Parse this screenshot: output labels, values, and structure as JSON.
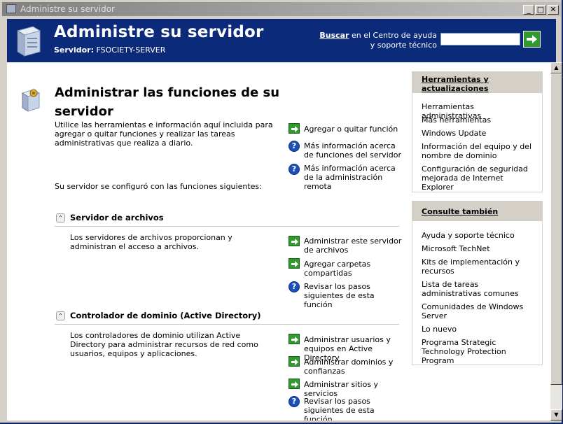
{
  "window": {
    "title": "Administre su servidor",
    "controls": {
      "minimize": "_",
      "maximize": "□",
      "close": "✕"
    }
  },
  "header": {
    "title": "Administre su servidor",
    "server_label": "Servidor:",
    "server_name": "FSOCIETY-SERVER",
    "search": {
      "label_bold": "Buscar",
      "label_rest": " en el Centro de ayuda y soporte técnico",
      "value": "",
      "placeholder": ""
    }
  },
  "main": {
    "title": "Administrar las funciones de su servidor",
    "intro": "Utilice las herramientas e información aquí incluida para agregar o quitar funciones y realizar las tareas administrativas que realiza a diario.",
    "configured": "Su servidor se configuró con las funciones siguientes:",
    "top_links": [
      {
        "label": "Agregar o quitar función",
        "icon": "arrow-right-icon"
      },
      {
        "label": "Más información acerca de funciones del servidor",
        "icon": "help-icon"
      },
      {
        "label": "Más información acerca de la administración remota",
        "icon": "help-icon"
      }
    ],
    "sections": [
      {
        "title": "Servidor de archivos",
        "description": "Los servidores de archivos proporcionan y administran el acceso a archivos.",
        "links": [
          {
            "label": "Administrar este servidor de archivos",
            "icon": "arrow-right-icon"
          },
          {
            "label": "Agregar carpetas compartidas",
            "icon": "arrow-right-icon"
          },
          {
            "label": "Revisar los pasos siguientes de esta función",
            "icon": "help-icon"
          }
        ]
      },
      {
        "title": "Controlador de dominio (Active Directory)",
        "description": "Los controladores de dominio utilizan Active Directory para administrar recursos de red como usuarios, equipos y aplicaciones.",
        "links": [
          {
            "label": "Administrar usuarios y equipos en Active Directory",
            "icon": "arrow-right-icon"
          },
          {
            "label": "Administrar dominios y confianzas",
            "icon": "arrow-right-icon"
          },
          {
            "label": "Administrar sitios y servicios",
            "icon": "arrow-right-icon"
          },
          {
            "label": "Revisar los pasos siguientes de esta función",
            "icon": "help-icon"
          }
        ]
      }
    ]
  },
  "sidebar": {
    "tools": {
      "title": "Herramientas y actualizaciones",
      "items": [
        "Herramientas administrativas",
        "Más herramientas",
        "Windows Update",
        "Información del equipo y del nombre de dominio",
        "Configuración de seguridad mejorada de Internet Explorer"
      ]
    },
    "see_also": {
      "title": "Consulte también",
      "items": [
        "Ayuda y soporte técnico",
        "Microsoft TechNet",
        "Kits de implementación y recursos",
        "Lista de tareas administrativas comunes",
        "Comunidades de Windows Server",
        "Lo nuevo",
        "Programa Strategic Technology Protection Program"
      ]
    }
  },
  "colors": {
    "header_bg": "#0b2a7a",
    "arrow_green": "#2f9b2f",
    "help_blue": "#1c50b8",
    "side_head": "#d4d0c8"
  }
}
